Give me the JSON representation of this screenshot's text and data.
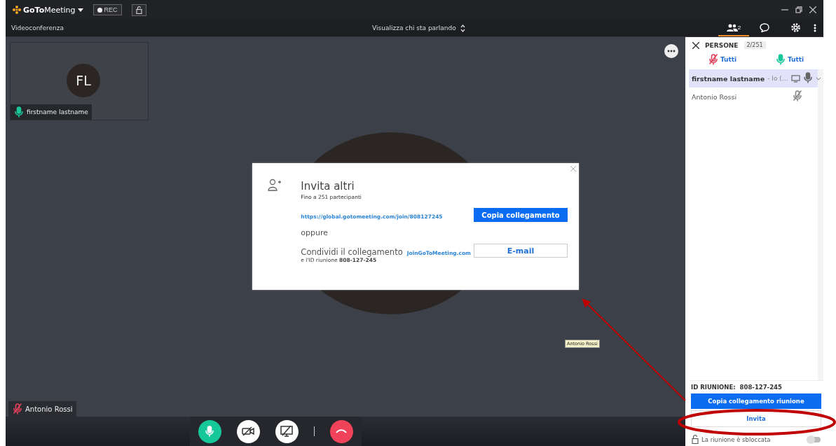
{
  "titlebar": {
    "logo": "**GoTo**Meeting",
    "rec": "REC"
  },
  "toolbar": {
    "title": "Videoconferenza",
    "view_mode": "Visualizza chi sta parlando",
    "people_count": "2",
    "tabs": [
      {
        "kind": "people",
        "selected": true
      },
      {
        "kind": "chat",
        "selected": false
      },
      {
        "kind": "settings",
        "selected": false
      }
    ]
  },
  "stage": {
    "thumbnail": {
      "initials": "FL",
      "name": "firstname lastname",
      "muted": false
    },
    "speaker": {
      "name": "Antonio Rossi",
      "muted": true
    },
    "tooltip": "Antonio Rossi",
    "controls": [
      {
        "kind": "mic",
        "on": true
      },
      {
        "kind": "camera",
        "on": false
      },
      {
        "kind": "screen",
        "on": false
      },
      {
        "kind": "hangup",
        "on": true
      }
    ]
  },
  "dialog": {
    "title": "Invita altri",
    "subtitle": "Fino a 251 partecipanti",
    "link": "https://global.gotomeeting.com/join/808127245",
    "copy_button": "Copia collegamento",
    "or": "oppure",
    "share_text": "Condividi il collegamento",
    "share_link": "JoinGoToMeeting.com",
    "meeting_id_text": "e l'ID riunione **808-127-245**",
    "email_button": "E-mail"
  },
  "panel": {
    "title": "PERSONE",
    "count": "2/251",
    "mute_all": "Tutti",
    "unmute_all": "Tutti",
    "participants": [
      {
        "name": "firstname lastname",
        "note": "- Io (…",
        "selected": true,
        "muted": false
      },
      {
        "name": "Antonio Rossi",
        "selected": false,
        "muted": true
      }
    ],
    "meeting_id_label": "ID RIUNIONE:",
    "meeting_id": "808-127-245",
    "copy_button": "Copia collegamento riunione",
    "invite_button": "Invita",
    "lock_text": "La riunione è sbloccata",
    "lock_toggle_on": false
  }
}
